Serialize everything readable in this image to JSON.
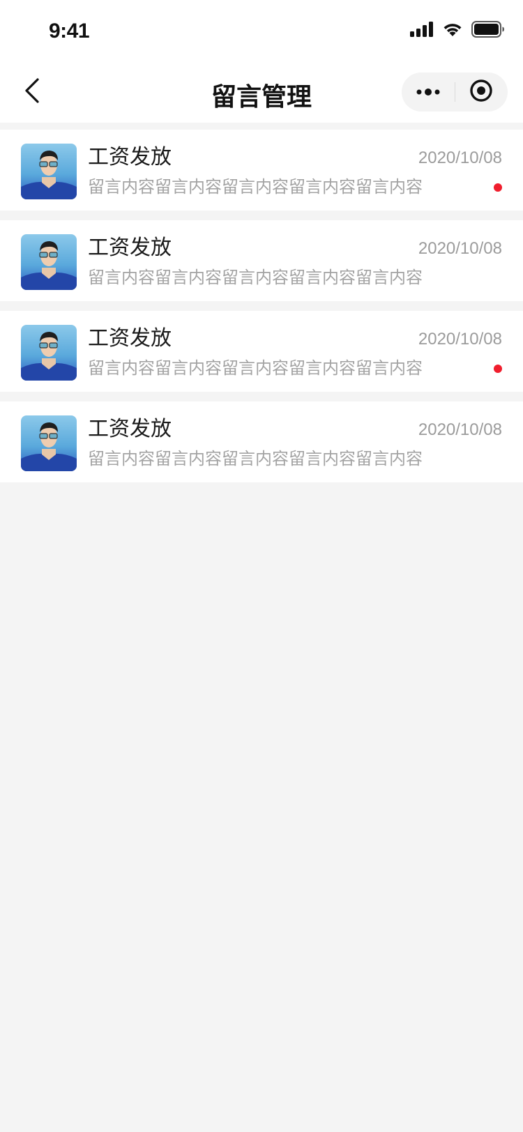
{
  "status_bar": {
    "time": "9:41",
    "icons": [
      "signal-icon",
      "wifi-icon",
      "battery-icon"
    ]
  },
  "nav": {
    "title": "留言管理",
    "back_icon": "chevron-left-icon",
    "more_icon": "more-dots-icon",
    "close_icon": "target-circle-icon"
  },
  "colors": {
    "unread_dot": "#f01e2d",
    "background": "#f4f4f4",
    "secondary_text": "#9b9b9b"
  },
  "messages": [
    {
      "title": "工资发放",
      "date": "2020/10/08",
      "content": "留言内容留言内容留言内容留言内容留言内容",
      "unread": true
    },
    {
      "title": "工资发放",
      "date": "2020/10/08",
      "content": "留言内容留言内容留言内容留言内容留言内容",
      "unread": false
    },
    {
      "title": "工资发放",
      "date": "2020/10/08",
      "content": "留言内容留言内容留言内容留言内容留言内容",
      "unread": true
    },
    {
      "title": "工资发放",
      "date": "2020/10/08",
      "content": "留言内容留言内容留言内容留言内容留言内容",
      "unread": false
    }
  ]
}
